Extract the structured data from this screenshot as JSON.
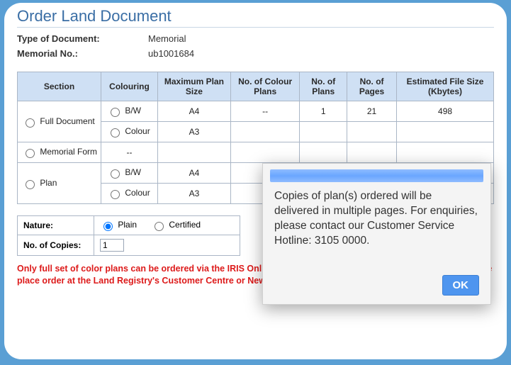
{
  "title": "Order Land Document",
  "meta": {
    "type_label": "Type of Document:",
    "type_value": "Memorial",
    "memno_label": "Memorial No.:",
    "memno_value": "ub1001684"
  },
  "headers": {
    "section": "Section",
    "colouring": "Colouring",
    "max_plan_size": "Maximum Plan Size",
    "no_colour_plans": "No. of Colour Plans",
    "no_plans": "No. of Plans",
    "no_pages": "No. of Pages",
    "est_size": "Estimated File Size (Kbytes)"
  },
  "sections": {
    "full_doc": {
      "label": "Full Document",
      "rows": [
        {
          "colouring": "B/W",
          "max": "A4",
          "colour_plans": "--",
          "plans": "1",
          "pages": "21",
          "size": "498"
        },
        {
          "colouring": "Colour",
          "max": "A3",
          "colour_plans": "",
          "plans": "",
          "pages": "",
          "size": ""
        }
      ]
    },
    "memorial_form": {
      "label": "Memorial Form",
      "row": {
        "colouring": "--",
        "max": "",
        "colour_plans": "",
        "plans": "",
        "pages": "",
        "size": ""
      }
    },
    "plan": {
      "label": "Plan",
      "rows": [
        {
          "colouring": "B/W",
          "max": "A4",
          "colour_plans": "",
          "plans": "",
          "pages": "",
          "size": ""
        },
        {
          "colouring": "Colour",
          "max": "A3",
          "colour_plans": "",
          "plans": "",
          "pages": "",
          "size": ""
        }
      ]
    }
  },
  "options": {
    "nature_label": "Nature:",
    "plain": "Plain",
    "certified": "Certified",
    "copies_label": "No. of Copies:",
    "copies_value": "1"
  },
  "warning": "Only full set of color plans can be ordered via the IRIS Online Services. For ordering individual color plan, please place order at the Land Registry's Customer Centre or New Territories Search Offices.",
  "modal": {
    "text": "Copies of plan(s) ordered will be delivered in multiple pages. For enquiries, please contact our Customer Service Hotline: 3105 0000.",
    "ok": "OK"
  }
}
